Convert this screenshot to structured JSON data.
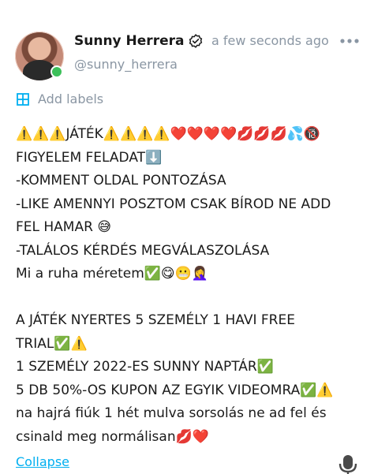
{
  "post": {
    "author_name": "Sunny Herrera",
    "handle": "@sunny_herrera",
    "timestamp": "a few seconds ago",
    "add_labels": "Add labels",
    "collapse": "Collapse",
    "body_lines": [
      "⚠️⚠️⚠️JÁTÉK⚠️⚠️⚠️⚠️❤️❤️❤️❤️💋💋💋💦🔞",
      "FIGYELEM FELADAT⬇️",
      "-KOMMENT OLDAL PONTOZÁSA",
      "-LIKE AMENNYI POSZTOM CSAK BÍROD NE ADD",
      "FEL HAMAR 😅",
      "-TALÁLOS KÉRDÉS MEGVÁLASZOLÁSA",
      "Mi a ruha méretem✅😋😬🤦‍♀️",
      "",
      "A JÁTÉK NYERTES 5 SZEMÉLY 1 HAVI FREE",
      "TRIAL✅⚠️",
      "1 SZEMÉLY 2022-ES SUNNY NAPTÁR✅",
      "5 DB 50%-OS KUPON AZ EGYIK VIDEOMRA✅⚠️",
      "na hajrá fiúk 1 hét mulva sorsolás ne ad fel és",
      "csinald meg normálisan💋❤️"
    ]
  },
  "colors": {
    "accent": "#00aff0",
    "muted_text": "#8a96a3",
    "online": "#3cc05a"
  },
  "icons": [
    "verified-icon",
    "more-icon",
    "labels-icon",
    "mic-icon"
  ]
}
